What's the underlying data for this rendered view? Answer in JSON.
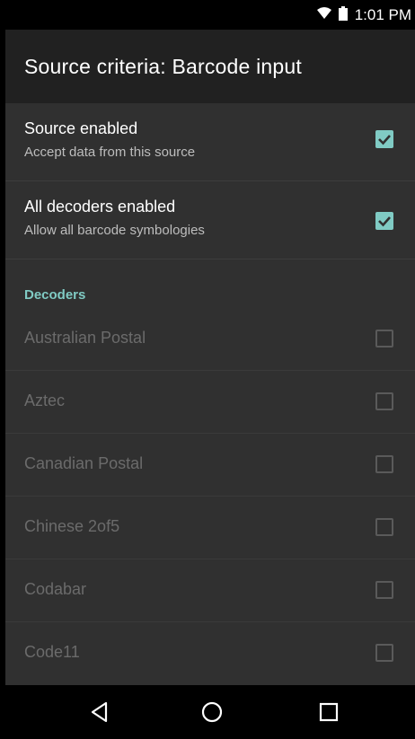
{
  "status_bar": {
    "time": "1:01 PM",
    "icons": [
      "wifi-icon",
      "battery-icon"
    ]
  },
  "app_bar": {
    "title": "Source criteria: Barcode input"
  },
  "preferences": [
    {
      "title": "Source enabled",
      "summary": "Accept data from this source",
      "checked": true
    },
    {
      "title": "All decoders enabled",
      "summary": "Allow all barcode symbologies",
      "checked": true
    }
  ],
  "decoders": {
    "category_label": "Decoders",
    "items": [
      {
        "label": "Australian Postal",
        "checked": false
      },
      {
        "label": "Aztec",
        "checked": false
      },
      {
        "label": "Canadian Postal",
        "checked": false
      },
      {
        "label": "Chinese 2of5",
        "checked": false
      },
      {
        "label": "Codabar",
        "checked": false
      },
      {
        "label": "Code11",
        "checked": false
      }
    ]
  },
  "nav_bar": {
    "icons": [
      "back-icon",
      "home-icon",
      "recents-icon"
    ]
  },
  "colors": {
    "accent": "#80cbc4",
    "background": "#303030",
    "app_bar": "#212121"
  }
}
